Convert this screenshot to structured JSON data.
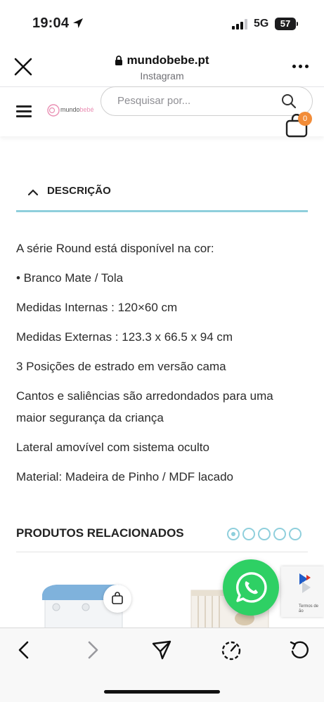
{
  "status_bar": {
    "time": "19:04",
    "network": "5G",
    "battery": "57"
  },
  "browser": {
    "domain": "mundobebe.pt",
    "source": "Instagram"
  },
  "site": {
    "logo_text_a": "mundo",
    "logo_text_b": "bebé",
    "search_placeholder": "Pesquisar por...",
    "cart_count": "0"
  },
  "description": {
    "title": "DESCRIÇÃO",
    "lines": [
      "A série Round está disponível na cor:",
      "• Branco Mate / Tola",
      "Medidas Internas : 120×60 cm",
      "Medidas Externas : 123.3 x 66.5 x 94 cm",
      "3 Posições de estrado em versão cama",
      "Cantos e saliências são arredondados para uma",
      "maior segurança da criança",
      "Lateral amovível com sistema oculto",
      "Material: Madeira de Pinho / MDF lacado"
    ]
  },
  "related": {
    "title": "PRODUTOS RELACIONADOS",
    "page_count": 5,
    "active_page": 1
  },
  "recaptcha": {
    "text": "Termos de",
    "text2": "ão"
  },
  "colors": {
    "accent": "#8fcfdc",
    "badge": "#f28c38",
    "whatsapp": "#2ed064"
  },
  "icons": [
    "location-arrow-icon",
    "close-icon",
    "lock-icon",
    "more-icon",
    "hamburger-icon",
    "search-icon",
    "cart-icon",
    "chevron-up-icon",
    "bag-icon",
    "whatsapp-icon",
    "back-icon",
    "forward-icon",
    "share-icon",
    "speedometer-icon",
    "reload-icon"
  ]
}
